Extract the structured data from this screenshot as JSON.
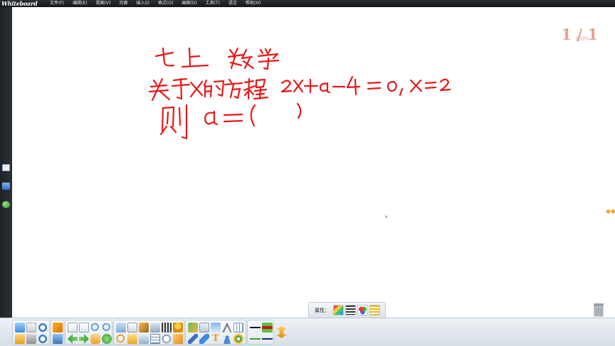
{
  "app": {
    "logo": "Whiteboard"
  },
  "menu": [
    "文件(F)",
    "编辑(E)",
    "视图(V)",
    "页面",
    "插入(I)",
    "格式(O)",
    "画图(D)",
    "工具(T)",
    "语言",
    "帮助(H)"
  ],
  "page": {
    "indicator": "1 / 1",
    "zoom": "100%"
  },
  "properties": {
    "label": "属性："
  },
  "handwriting": {
    "line1": "七上 数学",
    "line2": "关于x的方程 2x+a-4=0, x=2",
    "line3": "则 a=(    )"
  },
  "colors": {
    "ink": "#e81818",
    "page_indicator": "#e8a090"
  }
}
